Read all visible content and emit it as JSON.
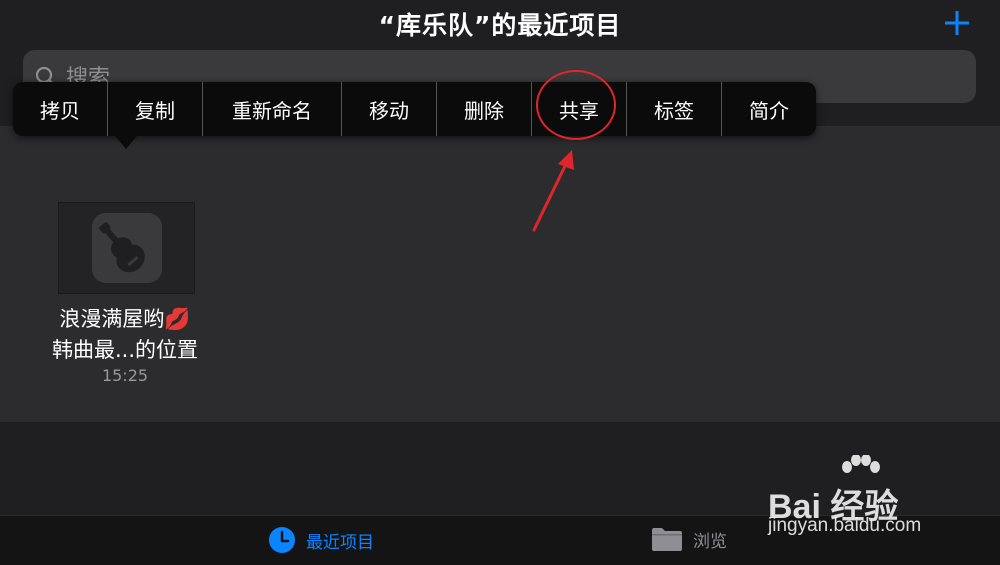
{
  "header": {
    "title": "“库乐队”的最近项目",
    "add_icon": "plus-icon",
    "accent_color": "#0a84ff"
  },
  "search": {
    "placeholder": "搜索",
    "icon": "search-icon"
  },
  "context_menu": {
    "items": [
      {
        "label": "拷贝"
      },
      {
        "label": "复制"
      },
      {
        "label": "重新命名"
      },
      {
        "label": "移动"
      },
      {
        "label": "删除"
      },
      {
        "label": "共享"
      },
      {
        "label": "标签"
      },
      {
        "label": "简介"
      }
    ]
  },
  "files": [
    {
      "name_line1": "浪漫满屋哟💋",
      "name_line2": "韩曲最...的位置",
      "time": "15:25",
      "icon": "guitar-icon"
    }
  ],
  "tabbar": {
    "tabs": [
      {
        "label": "最近项目",
        "icon": "clock-icon",
        "active": true,
        "color": "#0a84ff"
      },
      {
        "label": "浏览",
        "icon": "folder-icon",
        "active": false,
        "color": "#8e8e93"
      }
    ]
  },
  "annotation": {
    "color": "#e0262a"
  },
  "watermark": {
    "logo": "Bai 经验",
    "url": "jingyan.baidu.com"
  }
}
